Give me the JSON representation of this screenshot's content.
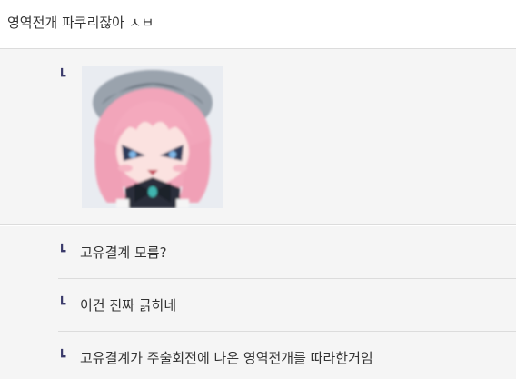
{
  "comment": {
    "text": "영역전개 파쿠리잖아 ㅅㅂ"
  },
  "replies": [
    {
      "type": "sticker",
      "arrow": "┗",
      "icon": "anime-girl-sticker"
    },
    {
      "type": "text",
      "arrow": "┗",
      "text": "고유결계 모름?"
    },
    {
      "type": "text",
      "arrow": "┗",
      "text": "이건 진짜 긁히네"
    },
    {
      "type": "text",
      "arrow": "┗",
      "text": "고유결계가 주술회전에 나온 영역전개를 따라한거임"
    }
  ],
  "colors": {
    "reply_background": "#f5f5f5",
    "divider": "#dcdcdc",
    "arrow": "#3a3a6a"
  }
}
